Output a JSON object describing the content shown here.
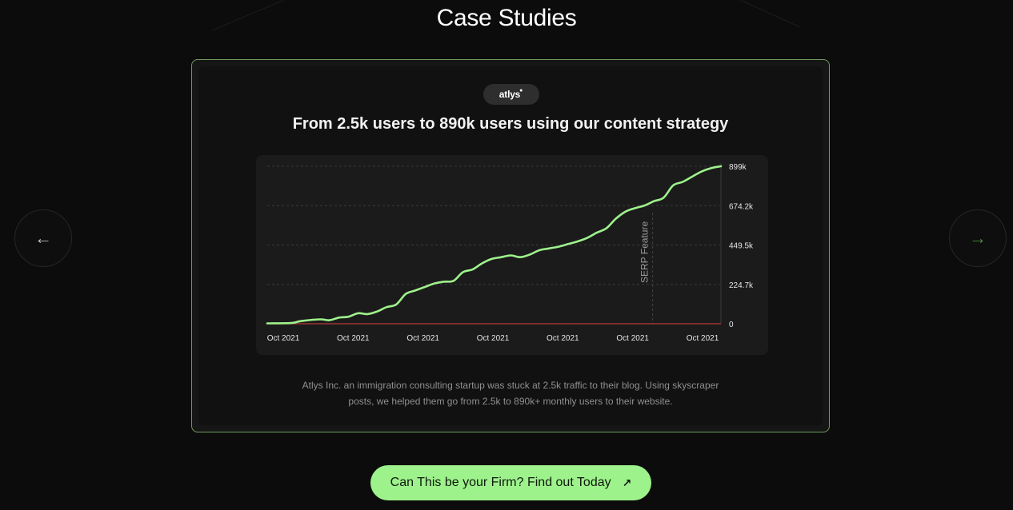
{
  "section": {
    "title": "Case Studies"
  },
  "case_study": {
    "logo_text": "atlys",
    "logo_mark": "●",
    "headline": "From 2.5k users to 890k users using our content strategy",
    "description": "Atlys Inc. an immigration consulting startup was stuck at 2.5k traffic to their blog. Using skyscraper posts, we helped them go from 2.5k to 890k+ monthly users to their website."
  },
  "navigation": {
    "prev_icon": "arrow-left-icon",
    "prev_glyph": "←",
    "next_icon": "arrow-right-icon",
    "next_glyph": "→"
  },
  "cta": {
    "label": "Can This be your Firm? Find out Today",
    "icon": "arrow-up-right-icon",
    "glyph": "↗"
  },
  "colors": {
    "background": "#0c0c0c",
    "card_border": "#6f9a5e",
    "accent_green": "#9ef28c",
    "series_line": "#9ef28c",
    "baseline": "#b33a3a"
  },
  "chart_data": {
    "type": "line",
    "categories": [
      "Oct 2021",
      "Oct 2021",
      "Oct 2021",
      "Oct 2021",
      "Oct 2021",
      "Oct 2021",
      "Oct 2021"
    ],
    "y_ticks": [
      "0",
      "224.7k",
      "449.5k",
      "674.2k",
      "899k"
    ],
    "y_tick_values": [
      0,
      224700,
      449500,
      674200,
      899000
    ],
    "ylim": [
      0,
      899000
    ],
    "grid": true,
    "annotation": {
      "label": "SERP Feature",
      "x": 80.7
    },
    "series": [
      {
        "values": [
          [
            0,
            2500
          ],
          [
            5,
            4000
          ],
          [
            7,
            15000
          ],
          [
            11,
            25000
          ],
          [
            13,
            20000
          ],
          [
            15,
            35000
          ],
          [
            17,
            40000
          ],
          [
            19,
            60000
          ],
          [
            21,
            55000
          ],
          [
            23,
            70000
          ],
          [
            25,
            95000
          ],
          [
            27,
            110000
          ],
          [
            29,
            170000
          ],
          [
            31,
            190000
          ],
          [
            33,
            210000
          ],
          [
            35,
            230000
          ],
          [
            37,
            240000
          ],
          [
            39,
            245000
          ],
          [
            41,
            295000
          ],
          [
            43,
            310000
          ],
          [
            45,
            345000
          ],
          [
            47,
            370000
          ],
          [
            49,
            380000
          ],
          [
            51,
            390000
          ],
          [
            53,
            380000
          ],
          [
            55,
            395000
          ],
          [
            57,
            420000
          ],
          [
            59,
            430000
          ],
          [
            61,
            440000
          ],
          [
            63,
            455000
          ],
          [
            65,
            470000
          ],
          [
            67,
            490000
          ],
          [
            69,
            520000
          ],
          [
            71,
            545000
          ],
          [
            73,
            600000
          ],
          [
            75,
            640000
          ],
          [
            77,
            660000
          ],
          [
            79,
            675000
          ],
          [
            81,
            700000
          ],
          [
            83,
            720000
          ],
          [
            85,
            790000
          ],
          [
            87,
            810000
          ],
          [
            89,
            840000
          ],
          [
            91,
            870000
          ],
          [
            93,
            889000
          ],
          [
            95,
            899000
          ]
        ]
      }
    ],
    "baseline": {
      "values": [
        [
          0,
          0
        ],
        [
          95,
          0
        ]
      ]
    }
  }
}
